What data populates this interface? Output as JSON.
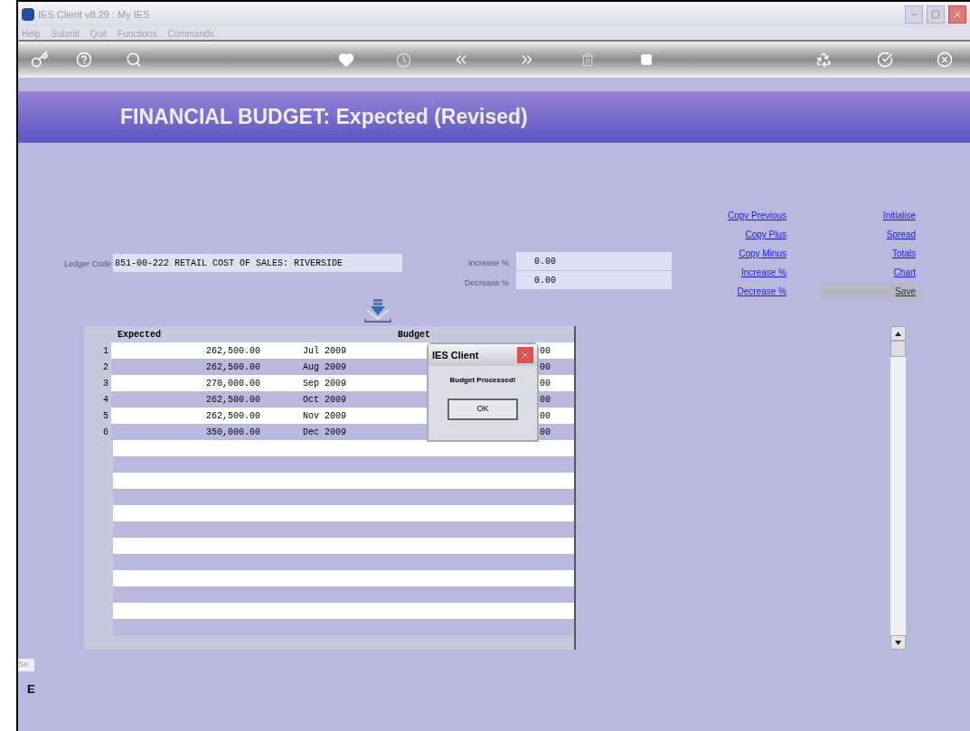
{
  "window": {
    "title": "IES Client v8.29 : My IES"
  },
  "menu": [
    "Help",
    "Submit",
    "Quit",
    "Functions",
    "Commands"
  ],
  "header": {
    "title": "FINANCIAL BUDGET: Expected (Revised)"
  },
  "ledger": {
    "label": "Ledger Code",
    "value": "851-00-222 RETAIL COST OF SALES: RIVERSIDE"
  },
  "percent_fields": [
    {
      "label": "Increase %",
      "value": "0.00"
    },
    {
      "label": "Decrease %",
      "value": "0.00"
    }
  ],
  "actions_left": [
    "Copy Previous",
    "Copy Plus",
    "Copy Minus",
    "Increase %",
    "Decrease %"
  ],
  "actions_right": [
    {
      "label": "Initialise",
      "selected": false
    },
    {
      "label": "Spread",
      "selected": false
    },
    {
      "label": "Totals",
      "selected": false
    },
    {
      "label": "Chart",
      "selected": false
    },
    {
      "label": "Save",
      "selected": true
    }
  ],
  "table": {
    "columns": [
      "Expected",
      "Budget"
    ],
    "rows": [
      {
        "number": "1",
        "expected": "262,500.00",
        "month": "Jul 2009",
        "budget": "00"
      },
      {
        "number": "2",
        "expected": "262,500.00",
        "month": "Aug 2009",
        "budget": "00"
      },
      {
        "number": "3",
        "expected": "270,000.00",
        "month": "Sep 2009",
        "budget": "00"
      },
      {
        "number": "4",
        "expected": "262,500.00",
        "month": "Oct 2009",
        "budget": "00"
      },
      {
        "number": "5",
        "expected": "262,500.00",
        "month": "Nov 2009",
        "budget": "00"
      },
      {
        "number": "6",
        "expected": "350,000.00",
        "month": "Dec 2009",
        "budget": "00"
      }
    ]
  },
  "dialog": {
    "title": "IES Client",
    "message": "Budget Processed!",
    "button": "OK"
  },
  "bottom": {
    "label": "Se",
    "value": "E"
  }
}
